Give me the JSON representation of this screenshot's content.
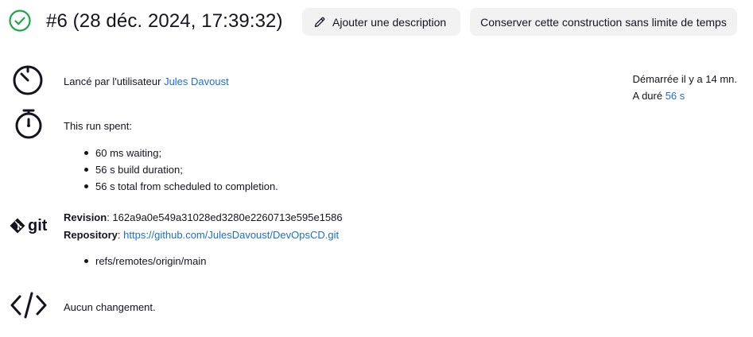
{
  "header": {
    "title": "#6 (28 déc. 2024, 17:39:32)",
    "status_color": "#1ea64b",
    "add_description_label": "Ajouter une description",
    "keep_forever_label": "Conserver cette construction sans limite de temps"
  },
  "cause": {
    "prefix": "Lancé par l'utilisateur ",
    "user": "Jules Davoust"
  },
  "timing": {
    "started": "Démarrée il y a 14 mn.",
    "duration_prefix": "A duré ",
    "duration": "56 s"
  },
  "run_time": {
    "heading": "This run spent:",
    "items": [
      "60 ms waiting;",
      "56 s build duration;",
      "56 s total from scheduled to completion."
    ]
  },
  "git": {
    "logo_text": "git",
    "revision_label": "Revision",
    "revision": "162a9a0e549a31028ed3280e2260713e595e1586",
    "repository_label": "Repository",
    "repository": "https://github.com/JulesDavoust/DevOpsCD.git",
    "branches": [
      "refs/remotes/origin/main"
    ]
  },
  "changes": {
    "text": "Aucun changement."
  },
  "colors": {
    "link": "#1a6ed8",
    "button_bg": "#f2f2f3",
    "text": "#14141f"
  },
  "icons": {
    "status": "check-circle-icon",
    "edit": "pencil-icon",
    "cause": "timer-icon",
    "runtime": "stopwatch-icon",
    "git": "git-logo-icon",
    "changes": "code-icon"
  }
}
